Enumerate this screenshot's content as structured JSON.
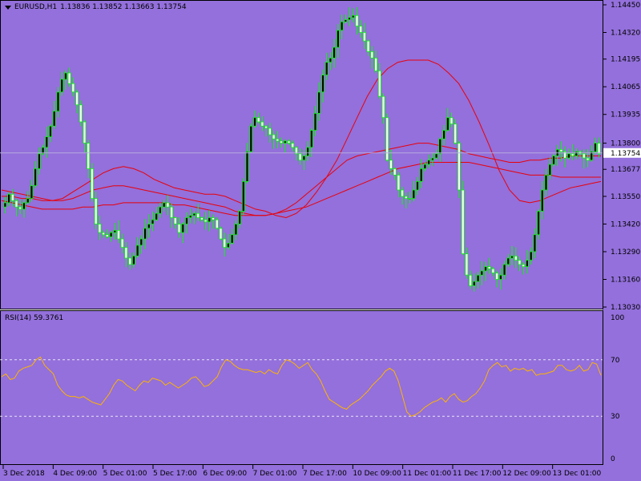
{
  "header": {
    "symbol_label": "EURUSD,H1",
    "ohlc": "1.13836 1.13852 1.13663 1.13754",
    "dropdown_icon": "triangle-down-icon"
  },
  "rsi_panel": {
    "label": "RSI(14) 59.3761",
    "scale": [
      "100",
      "70",
      "30",
      "0"
    ]
  },
  "price_axis": [
    "1.14450",
    "1.14320",
    "1.14195",
    "1.14065",
    "1.13935",
    "1.13800",
    "1.13677",
    "1.13550",
    "1.13420",
    "1.13290",
    "1.13160",
    "1.13030"
  ],
  "current_price": "1.13754",
  "time_axis": [
    "3 Dec 2018",
    "4 Dec 09:00",
    "5 Dec 01:00",
    "5 Dec 17:00",
    "6 Dec 09:00",
    "7 Dec 01:00",
    "7 Dec 17:00",
    "10 Dec 09:00",
    "11 Dec 01:00",
    "11 Dec 17:00",
    "12 Dec 09:00",
    "13 Dec 01:00"
  ],
  "colors": {
    "background": "#9370DB",
    "candle": "#00FF00",
    "moving_average": "#E8000B",
    "rsi_line": "#FFB300",
    "grid": "#FFFFFF"
  },
  "chart_data": {
    "type": "line",
    "series": [
      {
        "values": [
          1.1352,
          1.1356,
          1.1353,
          1.135,
          1.1349,
          1.1352,
          1.1354,
          1.136,
          1.1368,
          1.1375,
          1.1378,
          1.1383,
          1.1388,
          1.1395,
          1.1404,
          1.141,
          1.1413,
          1.1408,
          1.1404,
          1.1398,
          1.139,
          1.138,
          1.1368,
          1.1354,
          1.1342,
          1.1338,
          1.1337,
          1.1336,
          1.1338,
          1.1339,
          1.1335,
          1.1331,
          1.1326,
          1.1323,
          1.1327,
          1.1332,
          1.1335,
          1.134,
          1.1342,
          1.1344,
          1.1347,
          1.135,
          1.1352,
          1.135,
          1.1345,
          1.1342,
          1.1338,
          1.1342,
          1.1345,
          1.1346,
          1.1347,
          1.1345,
          1.1344,
          1.1343,
          1.1345,
          1.1344,
          1.134,
          1.1335,
          1.1331,
          1.1333,
          1.1337,
          1.1342,
          1.1348,
          1.1362,
          1.1376,
          1.1388,
          1.1392,
          1.139,
          1.1388,
          1.1387,
          1.1384,
          1.1382,
          1.1381,
          1.138,
          1.1381,
          1.138,
          1.1378,
          1.1375,
          1.1372,
          1.1374,
          1.1378,
          1.1386,
          1.1394,
          1.1404,
          1.1412,
          1.1418,
          1.142,
          1.1425,
          1.1433,
          1.1437,
          1.1438,
          1.1439,
          1.144,
          1.1435,
          1.1432,
          1.1428,
          1.1423,
          1.142,
          1.1414,
          1.1402,
          1.1392,
          1.1372,
          1.1368,
          1.1365,
          1.1358,
          1.1355,
          1.1354,
          1.1354,
          1.1358,
          1.1362,
          1.1368,
          1.137,
          1.1372,
          1.1373,
          1.1375,
          1.1382,
          1.1386,
          1.1392,
          1.1389,
          1.138,
          1.1358,
          1.1328,
          1.1318,
          1.1313,
          1.1315,
          1.1318,
          1.132,
          1.1322,
          1.1321,
          1.1319,
          1.1316,
          1.1318,
          1.1323,
          1.1326,
          1.1327,
          1.1325,
          1.1323,
          1.1322,
          1.1325,
          1.1329,
          1.1337,
          1.1348,
          1.1358,
          1.1365,
          1.137,
          1.1374,
          1.1377,
          1.1376,
          1.1373,
          1.1375,
          1.1374,
          1.1376,
          1.1375,
          1.1373,
          1.1372,
          1.1376,
          1.138,
          1.1375
        ],
        "ma_fast": [
          1.1355,
          1.1355,
          1.1354,
          1.1354,
          1.1353,
          1.1353,
          1.1354,
          1.1357,
          1.136,
          1.1363,
          1.1366,
          1.1368,
          1.1369,
          1.1368,
          1.1366,
          1.1363,
          1.1361,
          1.1359,
          1.1358,
          1.1357,
          1.1356,
          1.1356,
          1.1355,
          1.1353,
          1.1351,
          1.1349,
          1.1348,
          1.1346,
          1.1345,
          1.1347,
          1.1351,
          1.1357,
          1.1364,
          1.1372,
          1.1382,
          1.1392,
          1.1402,
          1.141,
          1.1415,
          1.1418,
          1.1419,
          1.1419,
          1.1419,
          1.1417,
          1.1413,
          1.1408,
          1.14,
          1.139,
          1.1379,
          1.1367,
          1.1358,
          1.1353,
          1.1352,
          1.1353,
          1.1355,
          1.1357,
          1.1359,
          1.136,
          1.1361,
          1.1362
        ],
        "ma_mid": [
          1.1358,
          1.1357,
          1.1356,
          1.1355,
          1.1354,
          1.1353,
          1.1353,
          1.1354,
          1.1356,
          1.1358,
          1.1359,
          1.136,
          1.136,
          1.1359,
          1.1358,
          1.1357,
          1.1356,
          1.1355,
          1.1354,
          1.1353,
          1.1352,
          1.1351,
          1.135,
          1.1348,
          1.1347,
          1.1346,
          1.1346,
          1.1347,
          1.1349,
          1.1352,
          1.1356,
          1.136,
          1.1364,
          1.1368,
          1.1372,
          1.1374,
          1.1375,
          1.1376,
          1.1377,
          1.1378,
          1.1379,
          1.138,
          1.138,
          1.1379,
          1.1378,
          1.1377,
          1.1375,
          1.1374,
          1.1373,
          1.1372,
          1.1371,
          1.1371,
          1.1372,
          1.1372,
          1.1373,
          1.1373,
          1.1374,
          1.1374,
          1.1374,
          1.1374
        ],
        "ma_slow": [
          1.1353,
          1.1352,
          1.1351,
          1.135,
          1.1349,
          1.1349,
          1.1349,
          1.1349,
          1.135,
          1.135,
          1.1351,
          1.1351,
          1.1352,
          1.1352,
          1.1352,
          1.1352,
          1.1352,
          1.1351,
          1.1351,
          1.135,
          1.1349,
          1.1348,
          1.1347,
          1.1346,
          1.1346,
          1.1346,
          1.1346,
          1.1347,
          1.1348,
          1.1349,
          1.135,
          1.1352,
          1.1354,
          1.1356,
          1.1358,
          1.136,
          1.1362,
          1.1364,
          1.1366,
          1.1368,
          1.1369,
          1.137,
          1.1371,
          1.1371,
          1.1371,
          1.1371,
          1.1371,
          1.137,
          1.1369,
          1.1368,
          1.1367,
          1.1366,
          1.1365,
          1.1365,
          1.1365,
          1.1364,
          1.1364,
          1.1364,
          1.1364,
          1.1364
        ]
      },
      {
        "name": "RSI(14)",
        "values": [
          58,
          60,
          56,
          57,
          62,
          64,
          65,
          66,
          70,
          72,
          66,
          63,
          60,
          52,
          48,
          45,
          44,
          44,
          43,
          44,
          42,
          40,
          39,
          38,
          42,
          46,
          52,
          56,
          55,
          52,
          50,
          48,
          52,
          55,
          54,
          57,
          56,
          55,
          52,
          54,
          52,
          50,
          52,
          54,
          57,
          58,
          55,
          51,
          52,
          55,
          58,
          65,
          70,
          69,
          66,
          64,
          63,
          63,
          62,
          61,
          62,
          60,
          63,
          61,
          60,
          66,
          70,
          69,
          67,
          64,
          66,
          68,
          63,
          60,
          55,
          48,
          42,
          40,
          38,
          36,
          35,
          38,
          40,
          42,
          45,
          48,
          52,
          55,
          58,
          62,
          64,
          62,
          55,
          44,
          33,
          30,
          31,
          33,
          36,
          38,
          40,
          41,
          43,
          40,
          44,
          46,
          42,
          40,
          41,
          44,
          46,
          50,
          55,
          63,
          66,
          68,
          65,
          66,
          62,
          64,
          63,
          64,
          62,
          63,
          59,
          60,
          60,
          61,
          62,
          66,
          66,
          63,
          62,
          63,
          66,
          62,
          63,
          68,
          67,
          59
        ]
      }
    ],
    "ylim": [
      1.1303,
      1.1445
    ],
    "rsi_ylim": [
      0,
      100
    ],
    "rsi_levels": [
      30,
      70
    ],
    "grid": false
  }
}
